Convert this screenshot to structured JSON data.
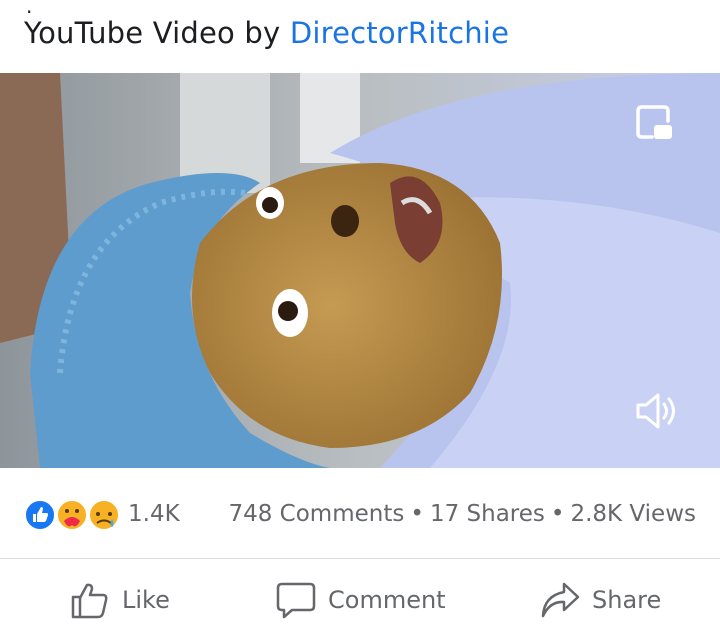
{
  "post": {
    "dot": ".",
    "prefix": "YouTube Video by ",
    "author": "DirectorRitchie"
  },
  "video": {
    "pip_icon": "picture-in-picture-icon",
    "sound_icon": "speaker-sound-icon"
  },
  "reactions": {
    "icons": [
      "like-reaction-icon",
      "care-reaction-icon",
      "sad-reaction-icon"
    ],
    "count": "1.4K"
  },
  "stats": {
    "comments": "748 Comments",
    "separator": "•",
    "shares": "17 Shares",
    "views": "2.8K Views"
  },
  "actions": {
    "like": "Like",
    "comment": "Comment",
    "share": "Share"
  },
  "colors": {
    "link": "#1b74e4",
    "muted": "#65676b",
    "like_blue": "#1877f2"
  }
}
